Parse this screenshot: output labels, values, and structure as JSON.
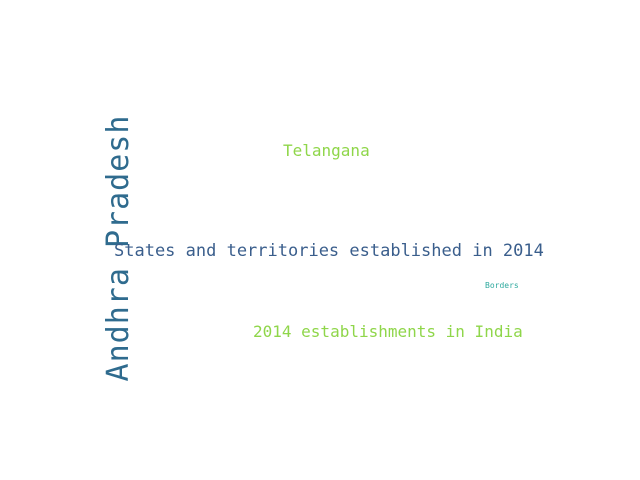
{
  "word_cloud": {
    "words": {
      "andhra_pradesh": "Andhra Pradesh",
      "telangana": "Telangana",
      "states_territories": "States and territories established in 2014",
      "borders": "Borders",
      "establishments": "2014 establishments in India"
    },
    "colors": {
      "andhra_pradesh": "#2f6b8e",
      "telangana": "#8fd64a",
      "states_territories": "#3a5e8c",
      "borders": "#2ea99e",
      "establishments": "#8fd64a"
    }
  }
}
